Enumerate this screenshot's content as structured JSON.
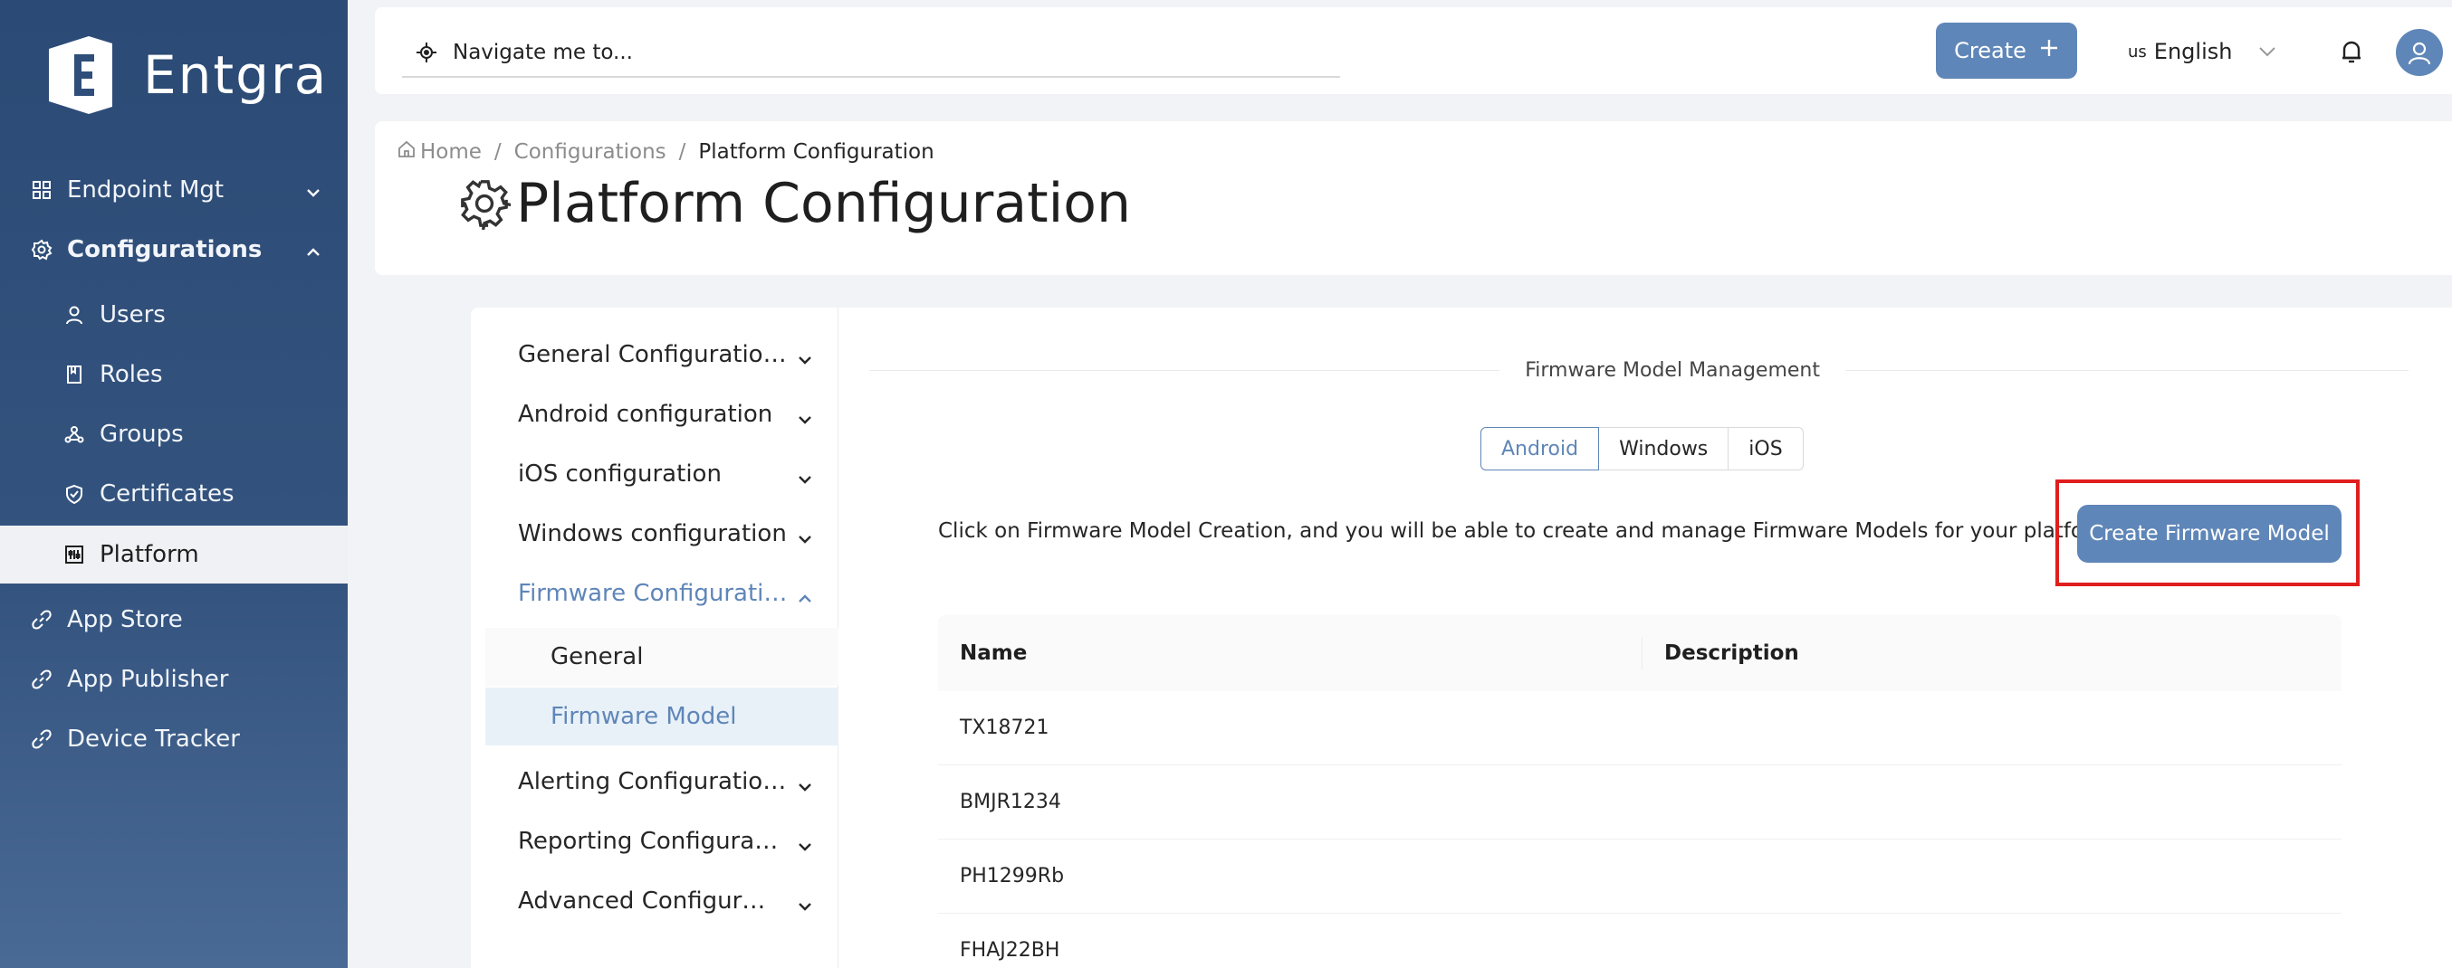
{
  "brand": {
    "name": "Entgra"
  },
  "sidebar": {
    "items": [
      {
        "label": "Endpoint Mgt",
        "icon": "grid-icon"
      },
      {
        "label": "Configurations",
        "icon": "gear-icon"
      },
      {
        "label": "Users",
        "icon": "user-icon"
      },
      {
        "label": "Roles",
        "icon": "book-icon"
      },
      {
        "label": "Groups",
        "icon": "groups-icon"
      },
      {
        "label": "Certificates",
        "icon": "shield-icon"
      },
      {
        "label": "Platform",
        "icon": "platform-icon"
      },
      {
        "label": "App Store",
        "icon": "link-icon"
      },
      {
        "label": "App Publisher",
        "icon": "link-icon"
      },
      {
        "label": "Device Tracker",
        "icon": "link-icon"
      }
    ]
  },
  "topbar": {
    "search_placeholder": "Navigate me to...",
    "create_label": "Create",
    "lang_code": "us",
    "lang_label": "English"
  },
  "header": {
    "breadcrumb": [
      "Home",
      "Configurations",
      "Platform Configuration"
    ],
    "title": "Platform Configuration"
  },
  "menu": {
    "items": [
      {
        "label": "General Configurations"
      },
      {
        "label": "Android configuration"
      },
      {
        "label": "iOS configuration"
      },
      {
        "label": "Windows configuration"
      },
      {
        "label": "Firmware Configuration"
      },
      {
        "label": "General"
      },
      {
        "label": "Firmware Model"
      },
      {
        "label": "Alerting Configurations"
      },
      {
        "label": "Reporting Configurations"
      },
      {
        "label": "Advanced Configurations"
      }
    ]
  },
  "panel": {
    "section_title": "Firmware Model Management",
    "platform_tabs": [
      "Android",
      "Windows",
      "iOS"
    ],
    "selected_tab": "Android",
    "hint": "Click on Firmware Model Creation, and you will be able to create and manage Firmware Models for your platform.",
    "create_button": "Create Firmware Model",
    "table": {
      "columns": [
        "Name",
        "Description"
      ],
      "rows": [
        {
          "name": "TX18721",
          "description": ""
        },
        {
          "name": "BMJR1234",
          "description": ""
        },
        {
          "name": "PH1299Rb",
          "description": ""
        },
        {
          "name": "FHAJ22BH",
          "description": ""
        }
      ]
    }
  },
  "colors": {
    "accent": "#5f86b8",
    "sidebar": "#2b4a75",
    "highlight": "#e01e1e"
  }
}
